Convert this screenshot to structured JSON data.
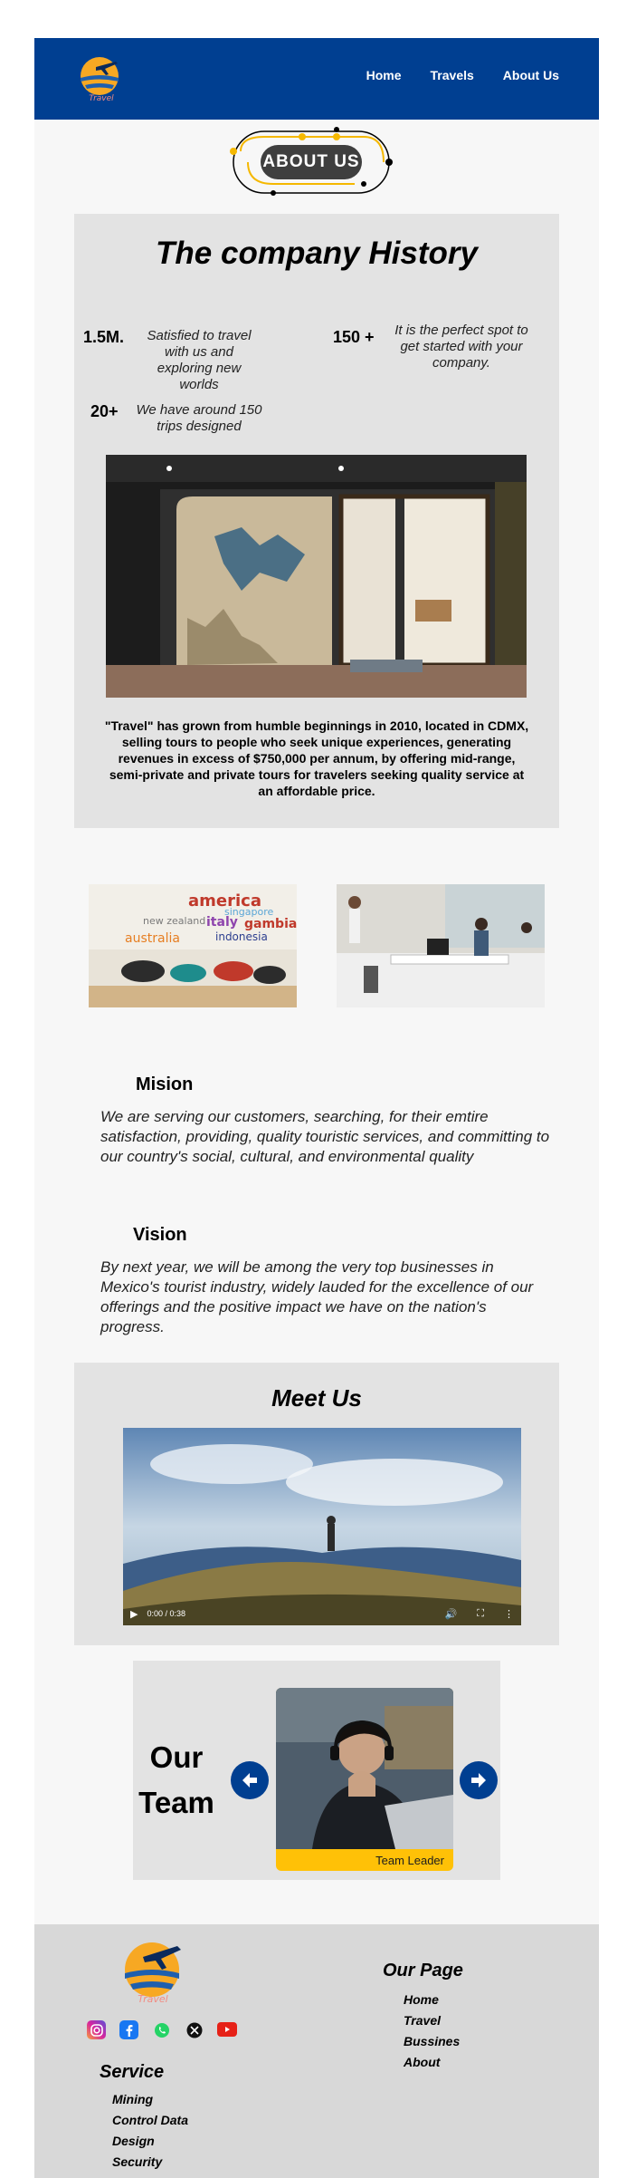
{
  "nav": {
    "logo_text": "Travel",
    "links": [
      "Home",
      "Travels",
      "About Us"
    ]
  },
  "about_badge": {
    "label": "ABOUT US"
  },
  "history": {
    "title": "The company History",
    "stats": [
      {
        "number": "1.5M.",
        "text": "Satisfied to travel with us and exploring new worlds"
      },
      {
        "number": "150 +",
        "text": "It is the perfect spot to get started with your company."
      },
      {
        "number": "20+",
        "text": "We have around 150 trips designed"
      }
    ],
    "photo_icon": "office-storefront-photo",
    "description": "\"Travel\" has grown from humble beginnings in 2010, located in CDMX, selling tours to people who seek unique experiences, generating revenues in excess of $750,000 per annum, by offering mid-range, semi-private and private tours for travelers seeking quality service at an affordable price."
  },
  "office_photos": {
    "left_words": [
      "america",
      "singapore",
      "new zealand",
      "italy",
      "gambia",
      "australia",
      "indonesia"
    ],
    "right_icon": "office-workspace-photo"
  },
  "mission": {
    "title": "Mision",
    "text": "We are serving our customers, searching, for their emtire satisfaction, providing, quality touristic services, and committing to our country's social, cultural, and environmental quality"
  },
  "vision": {
    "title": "Vision",
    "text": "By next year, we will be among the very top businesses in Mexico's tourist industry, widely lauded for the excellence of our offerings and the positive impact we have on the nation's progress."
  },
  "meet": {
    "title": "Meet Us",
    "video_time": "0:00 / 0:38"
  },
  "team": {
    "title_line1": "Our",
    "title_line2": "Team",
    "member_role": "Team Leader"
  },
  "footer": {
    "logo_text": "Travel",
    "socials": [
      "instagram-icon",
      "facebook-icon",
      "whatsapp-icon",
      "x-icon",
      "youtube-icon"
    ],
    "our_page_title": "Our Page",
    "our_page_links": [
      "Home",
      "Travel",
      "Bussines",
      "About"
    ],
    "service_title": "Service",
    "service_links": [
      "Mining",
      "Control Data",
      "Design",
      "Security"
    ]
  },
  "colors": {
    "brand_blue": "#003f91",
    "accent_yellow": "#ffc107",
    "panel_gray": "#e3e3e3",
    "footer_gray": "#d8d8d8"
  }
}
